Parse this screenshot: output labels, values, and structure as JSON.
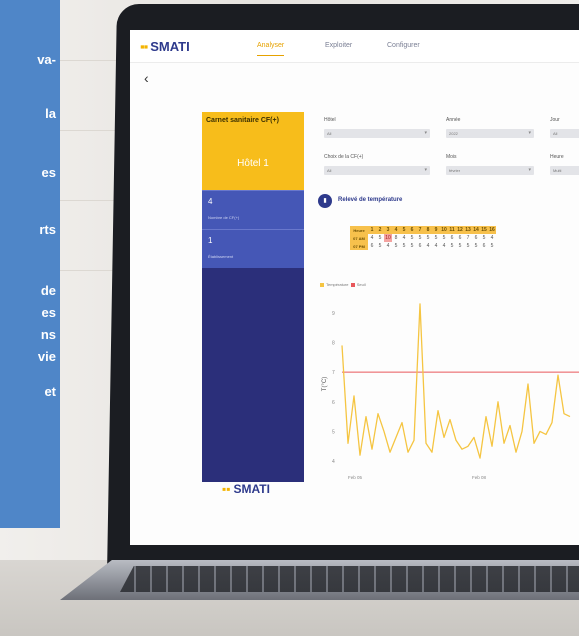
{
  "promo_lines": [
    "va-",
    "la",
    "es",
    "rts",
    "de",
    "es",
    "ns",
    "vie",
    "et"
  ],
  "app": {
    "logo_text": "SMATI",
    "tabs": [
      "Analyser",
      "Exploiter",
      "Configurer"
    ],
    "active_tab": "Analyser",
    "back_symbol": "‹"
  },
  "sidebar": {
    "title": "Carnet sanitaire CF(+)",
    "hotel_label": "Hôtel 1",
    "cards": [
      {
        "value": "4",
        "label": "Nombre de CF(+)"
      },
      {
        "value": "1",
        "label": "Établissement"
      }
    ],
    "logo_text": "SMATI"
  },
  "filters": {
    "hotel_label": "Hôtel",
    "hotel_value": "All",
    "year_label": "Année",
    "year_value": "2022",
    "day_label": "Jour",
    "day_value": "All",
    "cf_label": "Choix de la CF(+)",
    "cf_value": "All",
    "month_label": "Mois",
    "month_value": "février",
    "hour_label": "Heure",
    "hour_value": "Multi"
  },
  "section": {
    "icon": "thermometer-icon",
    "title": "Relevé de température"
  },
  "temp_table": {
    "header_label": "Heure",
    "hours": [
      "1",
      "2",
      "3",
      "4",
      "5",
      "6",
      "7",
      "8",
      "9",
      "10",
      "11",
      "12",
      "13",
      "14",
      "15",
      "16"
    ],
    "rows": [
      {
        "label": "07 AM",
        "values": [
          "4",
          "5",
          "10",
          "8",
          "4",
          "5",
          "5",
          "5",
          "5",
          "5",
          "6",
          "6",
          "7",
          "6",
          "5",
          "4"
        ],
        "highlight_index": 2
      },
      {
        "label": "07 PM",
        "values": [
          "6",
          "5",
          "4",
          "5",
          "5",
          "5",
          "6",
          "4",
          "4",
          "4",
          "5",
          "5",
          "5",
          "5",
          "6",
          "5"
        ],
        "highlight_index": -1
      }
    ]
  },
  "colors": {
    "brand_navy": "#2b2f7a",
    "accent_yellow": "#f7bd1b",
    "series": "#f5c542",
    "threshold": "#e8575b"
  },
  "chart_data": {
    "type": "line",
    "legend": [
      "Température",
      "Seuil"
    ],
    "ylabel": "T(°C)",
    "y_ticks": [
      "4",
      "5",
      "6",
      "7",
      "8",
      "9"
    ],
    "x_ticks": [
      "Feb 05",
      "Feb 08"
    ],
    "ylim": [
      3.7,
      9.5
    ],
    "threshold": 7,
    "series": [
      {
        "name": "Température",
        "values": [
          7.9,
          4.6,
          6.2,
          4.2,
          5.5,
          4.4,
          5.6,
          5.0,
          4.3,
          4.8,
          5.3,
          4.3,
          4.7,
          9.3,
          4.6,
          4.3,
          5.7,
          4.8,
          5.4,
          4.7,
          4.4,
          4.5,
          4.8,
          4.1,
          5.5,
          4.5,
          6.0,
          4.6,
          5.2,
          4.3,
          5.0,
          6.6,
          4.6,
          5.0,
          4.9,
          5.3,
          6.9,
          5.6,
          5.5
        ]
      }
    ]
  }
}
